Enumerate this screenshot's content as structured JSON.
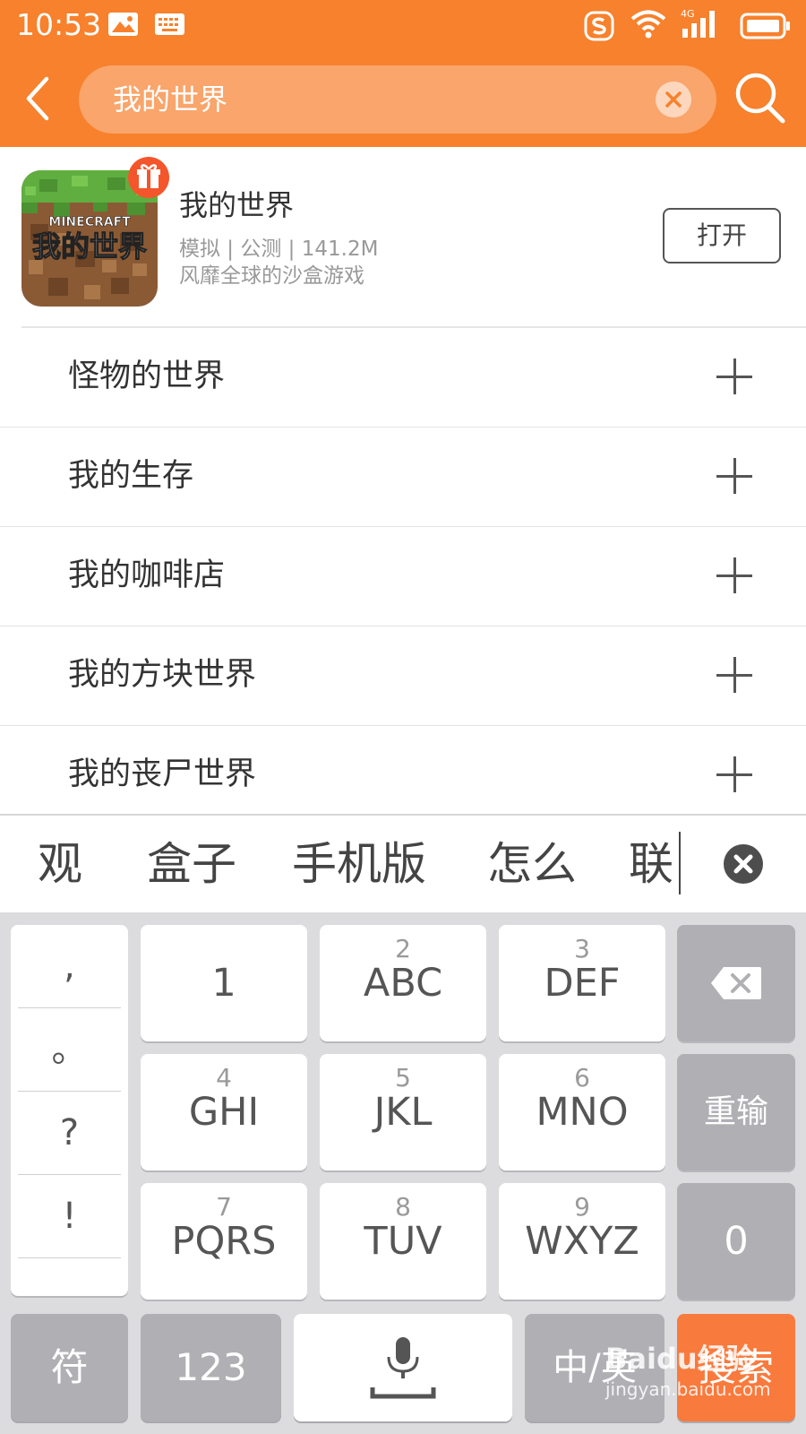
{
  "status_bar": {
    "time": "10:53",
    "icons": [
      "image-notification-icon",
      "keyboard-notification-icon",
      "sogou-icon",
      "wifi-icon",
      "signal-4g-icon",
      "battery-icon"
    ],
    "network_label": "4G"
  },
  "header": {
    "back_icon": "chevron-left-icon",
    "search_value": "我的世界",
    "clear_icon": "clear-icon",
    "search_icon": "search-icon",
    "accent_color": "#f7812c"
  },
  "featured_app": {
    "name": "我的世界",
    "meta": "模拟 | 公测 | 141.2M",
    "description": "风靡全球的沙盒游戏",
    "open_label": "打开",
    "icon_text_top": "MINECRAFT",
    "icon_text_bottom": "我的世界",
    "badge_icon": "gift-icon"
  },
  "suggestions": [
    {
      "label": "怪物的世界"
    },
    {
      "label": "我的生存"
    },
    {
      "label": "我的咖啡店"
    },
    {
      "label": "我的方块世界"
    },
    {
      "label": "我的丧尸世界"
    }
  ],
  "candidates": [
    "观",
    "盒子",
    "手机版",
    "怎么",
    "联"
  ],
  "keyboard": {
    "punctuation": [
      ",",
      "。",
      "?",
      "!"
    ],
    "keys": [
      {
        "num": "",
        "letters": "1"
      },
      {
        "num": "2",
        "letters": "ABC"
      },
      {
        "num": "3",
        "letters": "DEF"
      },
      {
        "num": "4",
        "letters": "GHI"
      },
      {
        "num": "5",
        "letters": "JKL"
      },
      {
        "num": "6",
        "letters": "MNO"
      },
      {
        "num": "7",
        "letters": "PQRS"
      },
      {
        "num": "8",
        "letters": "TUV"
      },
      {
        "num": "9",
        "letters": "WXYZ"
      }
    ],
    "reinput_label": "重输",
    "zero_label": "0",
    "symbol_label": "符",
    "numeric_label": "123",
    "lang_label": "中/英",
    "search_label": "搜索",
    "search_key_color": "#f97a3d"
  },
  "watermark": {
    "line1": "Baidu经验",
    "line2": "jingyan.baidu.com"
  }
}
